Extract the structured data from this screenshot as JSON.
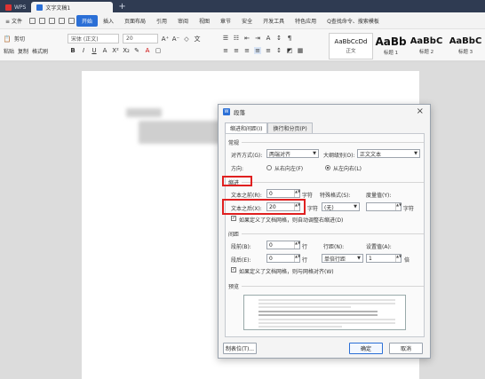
{
  "titlebar": {
    "app_tab": "WPS",
    "doc_tab": "文字文稿1",
    "new_tab": "+"
  },
  "menubar": {
    "file": "文件",
    "items": [
      "开始",
      "插入",
      "页面布局",
      "引用",
      "审阅",
      "视图",
      "章节",
      "安全",
      "开发工具",
      "特色应用"
    ],
    "search": "Q查找命令、搜索模板"
  },
  "ribbon": {
    "cut": "剪切",
    "paste": "粘贴",
    "copy": "复制",
    "format_painter": "格式刷",
    "font_name": "宋体 (正文)",
    "font_size": "20",
    "styles": [
      {
        "sample": "AaBbCcDd",
        "name": "正文"
      },
      {
        "sample": "AaBb",
        "name": "标题 1"
      },
      {
        "sample": "AaBbC",
        "name": "标题 2"
      },
      {
        "sample": "AaBbC",
        "name": "标题 3"
      }
    ]
  },
  "dialog": {
    "title": "段落",
    "tabs": [
      "缩进和间距(I)",
      "换行和分页(P)"
    ],
    "general": {
      "section": "常规",
      "align_label": "对齐方式(G):",
      "align_value": "两端对齐",
      "outline_label": "大纲级别(O):",
      "outline_value": "正文文本",
      "direction_label": "方向:",
      "rtl": "从右向左(F)",
      "ltr": "从左向右(L)"
    },
    "indent": {
      "section": "缩进",
      "before_label": "文本之前(R):",
      "before_value": "0",
      "after_label": "文本之后(X):",
      "after_value": "20",
      "unit": "字符",
      "special_label": "特殊格式(S):",
      "special_value": "(无)",
      "measure_label": "度量值(Y):",
      "grid_check": "如果定义了文档网格，则自动调整右缩进(D)"
    },
    "spacing": {
      "section": "间距",
      "before_label": "段前(B):",
      "before_value": "0",
      "after_label": "段后(E):",
      "after_value": "0",
      "unit": "行",
      "line_label": "行距(N):",
      "line_value": "单倍行距",
      "at_label": "设置值(A):",
      "at_value": "1",
      "at_unit": "倍",
      "grid_check": "如果定义了文档网格，则与网格对齐(W)"
    },
    "preview_label": "预览",
    "buttons": {
      "tabs": "制表位(T)...",
      "ok": "确定",
      "cancel": "取消"
    }
  }
}
